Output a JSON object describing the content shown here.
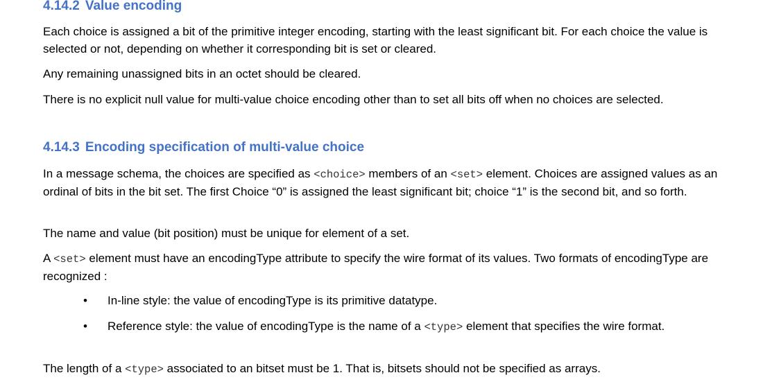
{
  "section_1": {
    "number": "4.14.2",
    "title": "Value encoding",
    "paragraphs": [
      "Each choice is assigned a bit of the primitive integer encoding, starting with the least significant bit. For each choice the value is selected or not, depending on whether it corresponding bit is set or cleared.",
      "Any remaining unassigned bits in an octet should be cleared.",
      "There is no explicit null value for multi-value choice encoding other than to set all bits off when no choices are selected."
    ]
  },
  "section_2": {
    "number": "4.14.3",
    "title": "Encoding specification of multi-value choice",
    "p1": {
      "t1": "In a message schema, the choices are specified as ",
      "c1": "<choice>",
      "t2": " members of an ",
      "c2": "<set>",
      "t3": " element. Choices are assigned values as an ordinal of bits in the bit set. The first Choice “0” is assigned the least significant bit; choice “1” is the second bit, and so forth."
    },
    "p2": "The name and value (bit position) must be unique for element of a set.",
    "p3": {
      "t1": "A ",
      "c1": "<set>",
      "t2": " element must have an encodingType attribute to specify the wire format of its values. Two formats of encodingType are recognized :"
    },
    "bullet_glyph": "•",
    "bullets": [
      {
        "text": "In-line style: the value of encodingType is its primitive datatype."
      },
      {
        "t1": "Reference style: the value of encodingType is the name of a ",
        "c1": "<type>",
        "t2": " element that specifies the wire format."
      }
    ],
    "p4": {
      "t1": "The length of a ",
      "c1": "<type>",
      "t2": " associated to an bitset must be 1. That is, bitsets should not be specified as arrays."
    }
  }
}
